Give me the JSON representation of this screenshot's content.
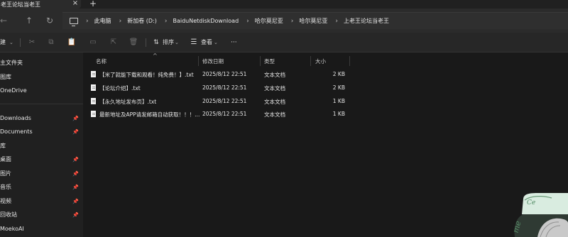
{
  "tab": {
    "title": "老王论坛当老王",
    "close_label": "×",
    "new_tab_label": "+"
  },
  "nav": {
    "back": "←",
    "forward": "→",
    "up": "↑",
    "refresh": "↻"
  },
  "breadcrumb": [
    "此电脑",
    "新加卷 (D:)",
    "BaiduNetdiskDownload",
    "哈尔莫尼亚",
    "哈尔莫尼亚",
    "上老王论坛当老王"
  ],
  "breadcrumb_sep": "›",
  "toolbar": {
    "new_label": "建",
    "sort_label": "排序",
    "view_label": "查看",
    "more_label": "···"
  },
  "sidebar": {
    "items": [
      {
        "label": "主文件夹",
        "pinned": false
      },
      {
        "label": "图库",
        "pinned": false
      },
      {
        "label": "OneDrive",
        "pinned": false
      },
      {
        "label": "Downloads",
        "pinned": true
      },
      {
        "label": "Documents",
        "pinned": true
      },
      {
        "label": "库",
        "pinned": false
      },
      {
        "label": "桌面",
        "pinned": true
      },
      {
        "label": "图片",
        "pinned": true
      },
      {
        "label": "音乐",
        "pinned": true
      },
      {
        "label": "视频",
        "pinned": true
      },
      {
        "label": "回收站",
        "pinned": true
      },
      {
        "label": "MoekoAI",
        "pinned": false
      }
    ]
  },
  "columns": {
    "name": "名称",
    "date": "修改日期",
    "type": "类型",
    "size": "大小"
  },
  "files": [
    {
      "name": "【米了就能下载和观看！纯免费！】.txt",
      "date": "2025/8/12 22:51",
      "type": "文本文档",
      "size": "2 KB"
    },
    {
      "name": "【论坛介绍】.txt",
      "date": "2025/8/12 22:51",
      "type": "文本文档",
      "size": "2 KB"
    },
    {
      "name": "【永久地址发布页】.txt",
      "date": "2025/8/12 22:51",
      "type": "文本文档",
      "size": "1 KB"
    },
    {
      "name": "最新地址及APP请发邮箱自动获取！！！...",
      "date": "2025/8/12 22:51",
      "type": "文本文档",
      "size": "1 KB"
    }
  ],
  "colors": {
    "background": "#191919",
    "sidebar": "#202020",
    "toolbar": "#272727",
    "accent": "#3a7a4a"
  }
}
